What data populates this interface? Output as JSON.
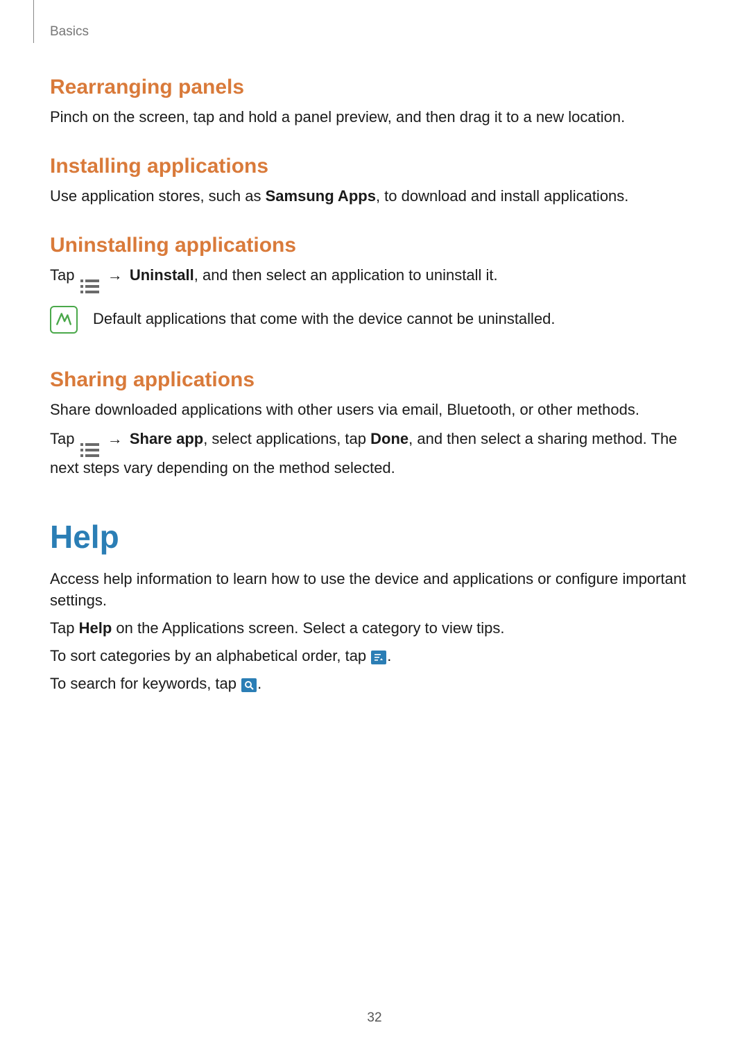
{
  "breadcrumb": "Basics",
  "sections": {
    "rearranging": {
      "title": "Rearranging panels",
      "body": "Pinch on the screen, tap and hold a panel preview, and then drag it to a new location."
    },
    "installing": {
      "title": "Installing applications",
      "body_pre": "Use application stores, such as ",
      "body_bold": "Samsung Apps",
      "body_post": ", to download and install applications."
    },
    "uninstalling": {
      "title": "Uninstalling applications",
      "tap": "Tap ",
      "arrow": " → ",
      "uninstall": "Uninstall",
      "rest": ", and then select an application to uninstall it.",
      "note": "Default applications that come with the device cannot be uninstalled."
    },
    "sharing": {
      "title": "Sharing applications",
      "intro": "Share downloaded applications with other users via email, Bluetooth, or other methods.",
      "tap": "Tap ",
      "arrow": " → ",
      "shareapp": "Share app",
      "mid": ", select applications, tap ",
      "done": "Done",
      "rest": ", and then select a sharing method. The next steps vary depending on the method selected."
    }
  },
  "help": {
    "title": "Help",
    "p1": "Access help information to learn how to use the device and applications or configure important settings.",
    "p2_pre": "Tap ",
    "p2_bold": "Help",
    "p2_post": " on the Applications screen. Select a category to view tips.",
    "p3_pre": "To sort categories by an alphabetical order, tap ",
    "p3_post": ".",
    "p4_pre": "To search for keywords, tap ",
    "p4_post": "."
  },
  "page_number": "32"
}
